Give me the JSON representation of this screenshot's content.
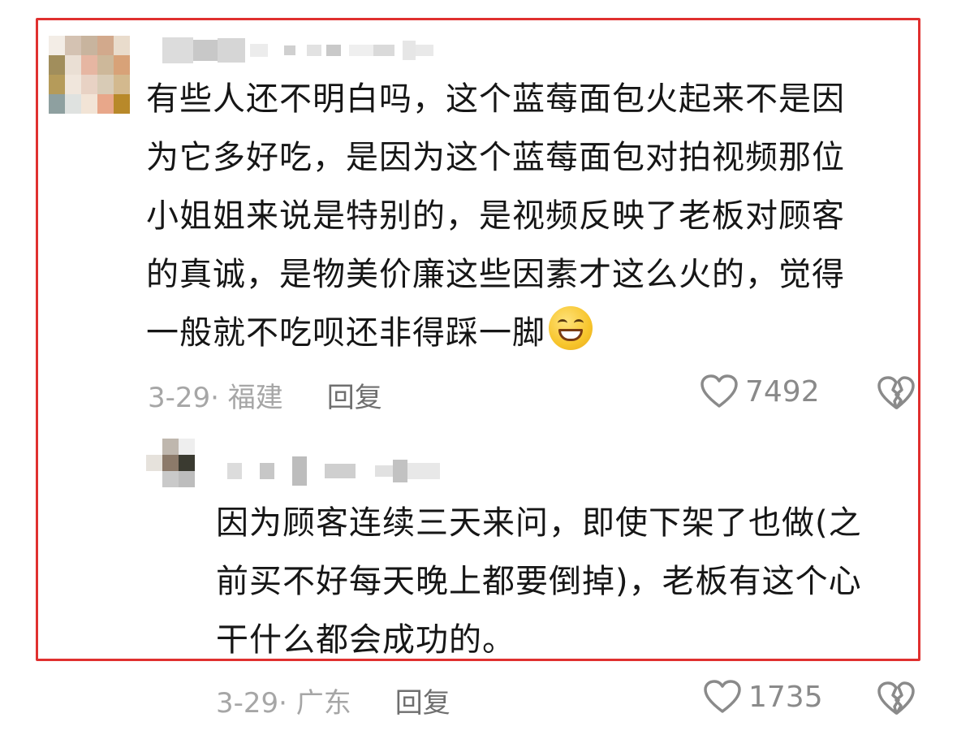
{
  "comment": {
    "text_lines": [
      "有些人还不明白吗，这个蓝莓面包火起来不是因",
      "为它多好吃，是因为这个蓝莓面包对拍视频那位",
      "小姐姐来说是特别的，是视频反映了老板对顾客",
      "的真诚，是物美价廉这些因素才这么火的，觉得",
      "一般就不吃呗还非得踩一脚"
    ],
    "emoji": "grinning-face-emoji",
    "date_location": "3-29· 福建",
    "reply_label": "回复",
    "like_count": "7492"
  },
  "reply": {
    "text_lines": [
      "因为顾客连续三天来问，即使下架了也做(之",
      "前买不好每天晚上都要倒掉)，老板有这个心",
      "干什么都会成功的。"
    ],
    "date_location": "3-29· 广东",
    "reply_label": "回复",
    "like_count": "1735"
  },
  "icons": {
    "like": "heart-outline-icon",
    "dislike": "broken-heart-icon"
  },
  "colors": {
    "highlight_border": "#e0302f",
    "meta_text": "#a6a6a6",
    "body_text": "#161616"
  }
}
